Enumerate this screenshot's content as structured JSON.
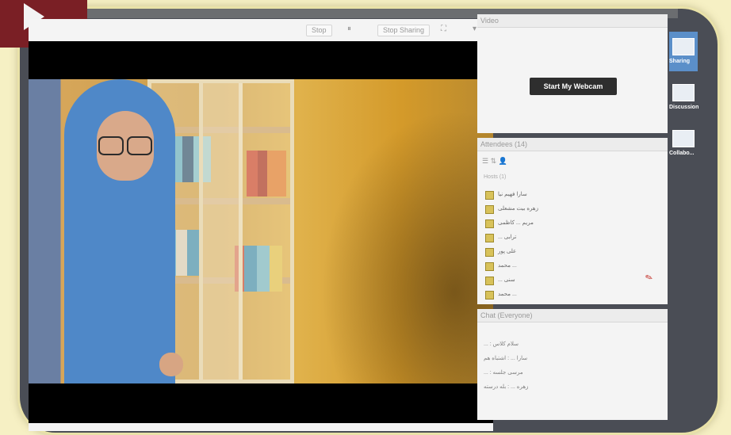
{
  "toolbar": {
    "stop_label": "Stop",
    "share_label": "Stop Sharing"
  },
  "video_pod": {
    "title": "Video",
    "webcam_button": "Start My Webcam"
  },
  "attendees_pod": {
    "title": "Attendees (14)",
    "section_label": "Hosts (1)",
    "names": [
      "سارا فهیم نیا",
      "زهره بیت مشعلی",
      "مریم ... کاظمی",
      "... ترابی",
      "علی پور",
      "محمد ...",
      "... سنی",
      "محمد ..."
    ]
  },
  "chat_pod": {
    "title": "Chat (Everyone)",
    "messages": [
      "... : سلام کلاس",
      "سارا ... : اشتباه هم",
      "... : مرسی جلسه",
      "زهره ... : بله درسته"
    ]
  },
  "layouts": [
    "Sharing",
    "Discussion",
    "Collabo..."
  ],
  "colors": {
    "frame": "#4a4d55",
    "background": "#f6f0c4",
    "webcam_button": "#2e2e2e",
    "accent_red": "#7a1f25"
  }
}
